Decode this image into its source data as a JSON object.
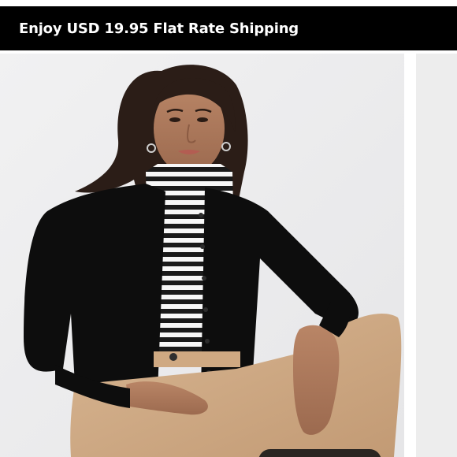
{
  "promo": {
    "text": "Enjoy USD 19.95 Flat Rate Shipping"
  },
  "product_image": {
    "alt": "Model wearing black button cardigan over a black and white striped turtleneck with camel wide-leg pants"
  },
  "colors": {
    "promo_background": "#000000",
    "promo_text": "#ffffff",
    "image_background": "#eeeeef"
  }
}
